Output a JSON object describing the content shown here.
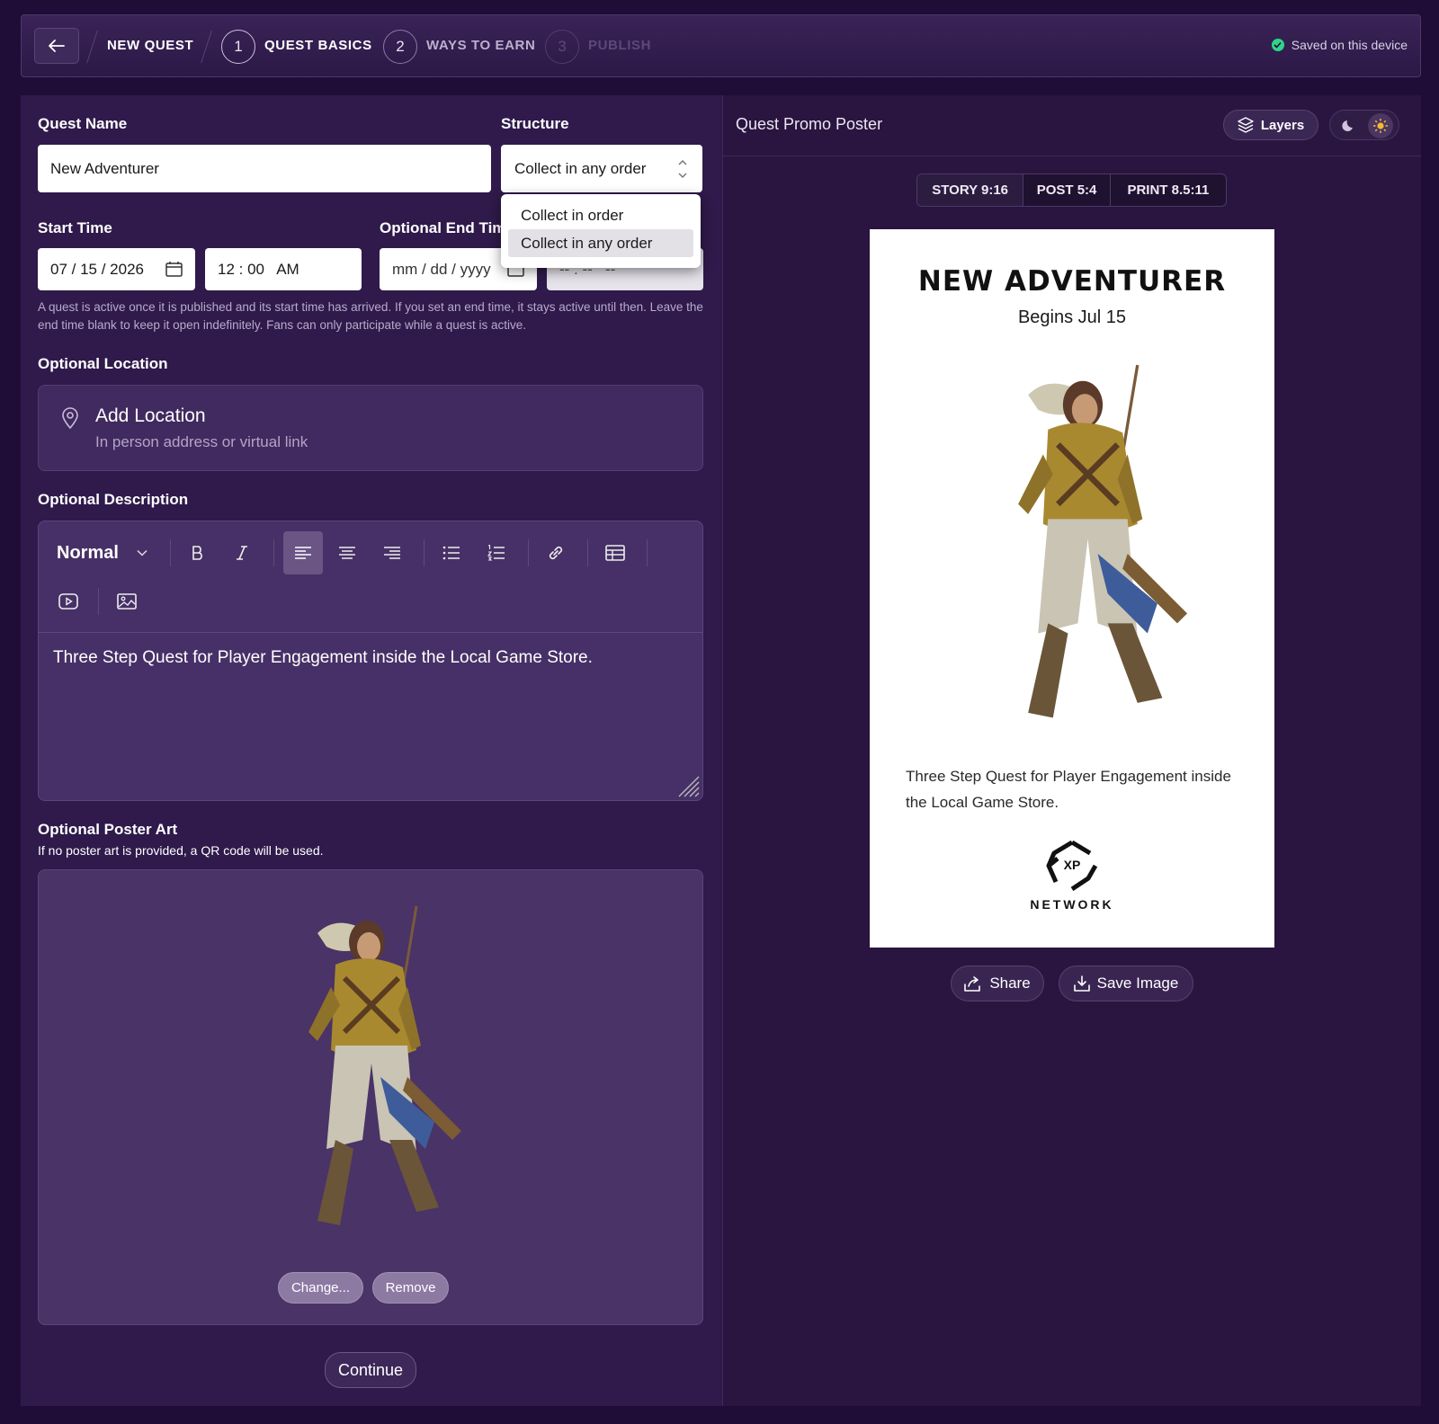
{
  "header": {
    "breadcrumb": "NEW QUEST",
    "steps": [
      {
        "number": "1",
        "label": "QUEST BASICS",
        "state": "active"
      },
      {
        "number": "2",
        "label": "WAYS TO EARN",
        "state": "upcoming"
      },
      {
        "number": "3",
        "label": "PUBLISH",
        "state": "disabled"
      }
    ],
    "save_status": "Saved on this device"
  },
  "form": {
    "quest_name": {
      "label": "Quest Name",
      "value": "New Adventurer"
    },
    "structure": {
      "label": "Structure",
      "value": "Collect in any order",
      "options": [
        "Collect in order",
        "Collect in any order"
      ]
    },
    "start_time": {
      "label": "Start Time",
      "date": "07 / 15 / 2026",
      "time": "12 : 00   AM"
    },
    "end_time": {
      "label": "Optional End Time",
      "visible_label": "Optional End Tim",
      "date_placeholder": "mm / dd / yyyy",
      "time_placeholder": "-- : --   --"
    },
    "help_text": "A quest is active once it is published and its start time has arrived. If you set an end time, it stays active until then. Leave the end time blank to keep it open indefinitely. Fans can only participate while a quest is active.",
    "location": {
      "label": "Optional Location",
      "title": "Add Location",
      "subtitle": "In person address or virtual link"
    },
    "description": {
      "label": "Optional Description",
      "format": "Normal",
      "text": "Three Step Quest for Player Engagement inside the Local Game Store."
    },
    "poster_art": {
      "label": "Optional Poster Art",
      "help": "If no poster art is provided, a QR code will be used.",
      "change_label": "Change...",
      "remove_label": "Remove"
    },
    "continue_label": "Continue"
  },
  "preview": {
    "title": "Quest Promo Poster",
    "layers_label": "Layers",
    "formats": [
      "STORY 9:16",
      "POST 5:4",
      "PRINT 8.5:11"
    ],
    "active_format": "STORY 9:16",
    "poster": {
      "title": "NEW ADVENTURER",
      "subtitle": "Begins Jul 15",
      "description": "Three Step Quest for Player Engagement inside the Local Game Store.",
      "logo_mark": "XP",
      "logo_text": "NETWORK"
    },
    "share_label": "Share",
    "save_label": "Save Image"
  },
  "colors": {
    "background": "#1f0d38",
    "panel": "#2f1a4b",
    "accent_green": "#2ed48a",
    "sun_icon": "#f5b82e"
  }
}
